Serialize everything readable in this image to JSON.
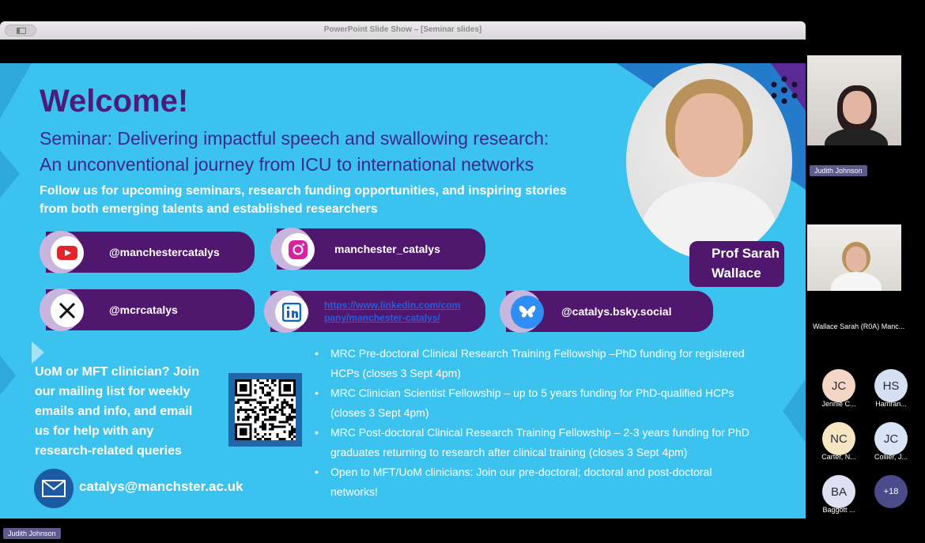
{
  "window": {
    "title": "PowerPoint Slide Show – [Seminar slides]"
  },
  "slide": {
    "welcome": "Welcome!",
    "subtitle_line1": "Seminar: Delivering impactful speech and swallowing research:",
    "subtitle_line2": "An unconventional journey from ICU to international networks",
    "follow_line1": "Follow us for upcoming seminars, research funding opportunities, and inspiring stories",
    "follow_line2": "from both emerging talents and established researchers",
    "socials": {
      "youtube": "@manchestercatalys",
      "instagram": "manchester_catalys",
      "x": "@mcrcatalys",
      "linkedin_line1": "https://www.linkedin.com/com",
      "linkedin_line2": "pany/manchester-catalys/",
      "bluesky": "@catalys.bsky.social"
    },
    "speaker_line1": "Prof Sarah",
    "speaker_line2": "Wallace",
    "mailing": [
      "UoM or MFT clinician? Join",
      "our mailing list for weekly",
      "emails and info, and email",
      "us for help with any",
      "research-related queries"
    ],
    "email": "catalys@manchster.ac.uk",
    "bullets": [
      [
        "MRC Pre-doctoral Clinical Research Training Fellowship –PhD funding for registered",
        "HCPs (closes 3 Sept 4pm)"
      ],
      [
        "MRC Clinician Scientist Fellowship – up to 5 years funding for PhD-qualified HCPs",
        "(closes 3 Sept 4pm)"
      ],
      [
        "MRC Post-doctoral Clinical Research Training Fellowship – 2-3 years funding for PhD",
        "graduates returning to research after clinical training (closes 3 Sept 4pm)"
      ],
      [
        "Open to MFT/UoM clinicians: Join our pre-doctoral; doctoral and post-doctoral",
        "networks!"
      ]
    ]
  },
  "participants": {
    "video1_name": "Judith Johnson",
    "video2_name": "Wallace Sarah (R0A) Manc...",
    "bottom_name": "Judith Johnson",
    "avatars": [
      {
        "initials": "JC",
        "name": "Jennie C...",
        "color": "#f4d6c6"
      },
      {
        "initials": "HS",
        "name": "Hamran...",
        "color": "#d7e0f3"
      },
      {
        "initials": "NC",
        "name": "Carter, N...",
        "color": "#f6e6c4"
      },
      {
        "initials": "JC",
        "name": "Collier, J...",
        "color": "#d8e3f5"
      },
      {
        "initials": "BA",
        "name": "Baggott ...",
        "color": "#dfe1f2"
      }
    ],
    "more_count": "+18"
  },
  "colors": {
    "slide_bg": "#3cc2ee",
    "pill": "#50176e",
    "title": "#4a1c7c"
  }
}
